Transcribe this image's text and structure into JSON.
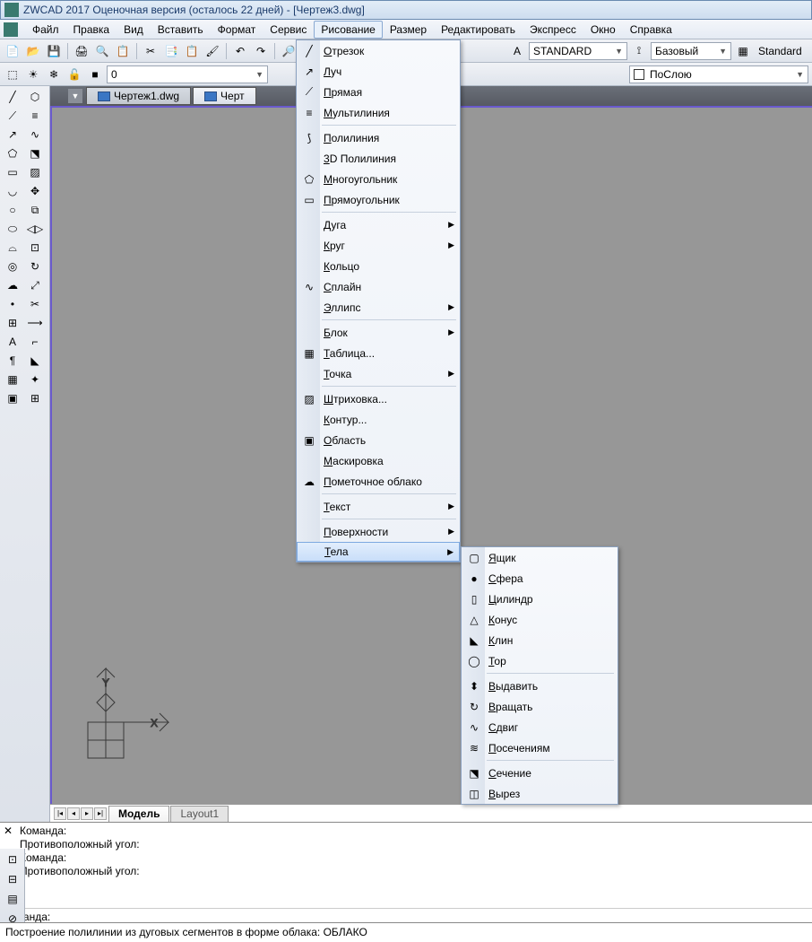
{
  "title": "ZWCAD 2017 Оценочная версия (осталось 22 дней) - [Чертеж3.dwg]",
  "menubar": [
    "Файл",
    "Правка",
    "Вид",
    "Вставить",
    "Формат",
    "Сервис",
    "Рисование",
    "Размер",
    "Редактировать",
    "Экспресс",
    "Окно",
    "Справка"
  ],
  "active_menu": "Рисование",
  "toolbar1": {
    "style_combo": "STANDARD",
    "dim_combo": "Базовый",
    "dim_combo2": "Standard"
  },
  "layerbar": {
    "layer_combo": "0",
    "layer_color_combo": "ПоСлою"
  },
  "filetabs": [
    {
      "name": "Чертеж1.dwg",
      "active": false
    },
    {
      "name": "Черт",
      "active": true
    }
  ],
  "draw_menu": [
    {
      "t": "Отрезок",
      "ico": "line"
    },
    {
      "t": "Луч",
      "ico": "ray"
    },
    {
      "t": "Прямая",
      "ico": "xline"
    },
    {
      "t": "Мультилиния",
      "ico": "mline"
    },
    {
      "sep": true
    },
    {
      "t": "Полилиния",
      "ico": "pline"
    },
    {
      "t": "3D Полилиния",
      "ico": ""
    },
    {
      "t": "Многоугольник",
      "ico": "poly"
    },
    {
      "t": "Прямоугольник",
      "ico": "rect"
    },
    {
      "sep": true
    },
    {
      "t": "Дуга",
      "sub": true
    },
    {
      "t": "Круг",
      "sub": true
    },
    {
      "t": "Кольцо"
    },
    {
      "t": "Сплайн",
      "ico": "spline"
    },
    {
      "t": "Эллипс",
      "sub": true
    },
    {
      "sep": true
    },
    {
      "t": "Блок",
      "sub": true
    },
    {
      "t": "Таблица...",
      "ico": "table"
    },
    {
      "t": "Точка",
      "sub": true
    },
    {
      "sep": true
    },
    {
      "t": "Штриховка...",
      "ico": "hatch"
    },
    {
      "t": "Контур..."
    },
    {
      "t": "Область",
      "ico": "region"
    },
    {
      "t": "Маскировка"
    },
    {
      "t": "Пометочное облако",
      "ico": "cloud"
    },
    {
      "sep": true
    },
    {
      "t": "Текст",
      "sub": true
    },
    {
      "sep": true
    },
    {
      "t": "Поверхности",
      "sub": true
    },
    {
      "t": "Тела",
      "sub": true,
      "hi": true
    }
  ],
  "solids_menu": [
    {
      "t": "Ящик",
      "ico": "box"
    },
    {
      "t": "Сфера",
      "ico": "sphere"
    },
    {
      "t": "Цилиндр",
      "ico": "cyl"
    },
    {
      "t": "Конус",
      "ico": "cone"
    },
    {
      "t": "Клин",
      "ico": "wedge"
    },
    {
      "t": "Тор",
      "ico": "torus"
    },
    {
      "sep": true
    },
    {
      "t": "Выдавить",
      "ico": "extr"
    },
    {
      "t": "Вращать",
      "ico": "rev"
    },
    {
      "t": "Сдвиг",
      "ico": "sweep"
    },
    {
      "t": "Посечениям",
      "ico": "loft"
    },
    {
      "sep": true
    },
    {
      "t": "Сечение",
      "ico": "sect"
    },
    {
      "t": "Вырез",
      "ico": "slice"
    }
  ],
  "sheet_tabs": [
    {
      "name": "Модель",
      "active": true
    },
    {
      "name": "Layout1",
      "active": false
    }
  ],
  "cmd_lines": [
    "Команда:",
    "Противоположный угол:",
    "Команда:",
    "Противоположный угол:"
  ],
  "cmd_prompt": "Команда:",
  "status": "Построение полилинии из дуговых сегментов в форме облака:  ОБЛАКО"
}
